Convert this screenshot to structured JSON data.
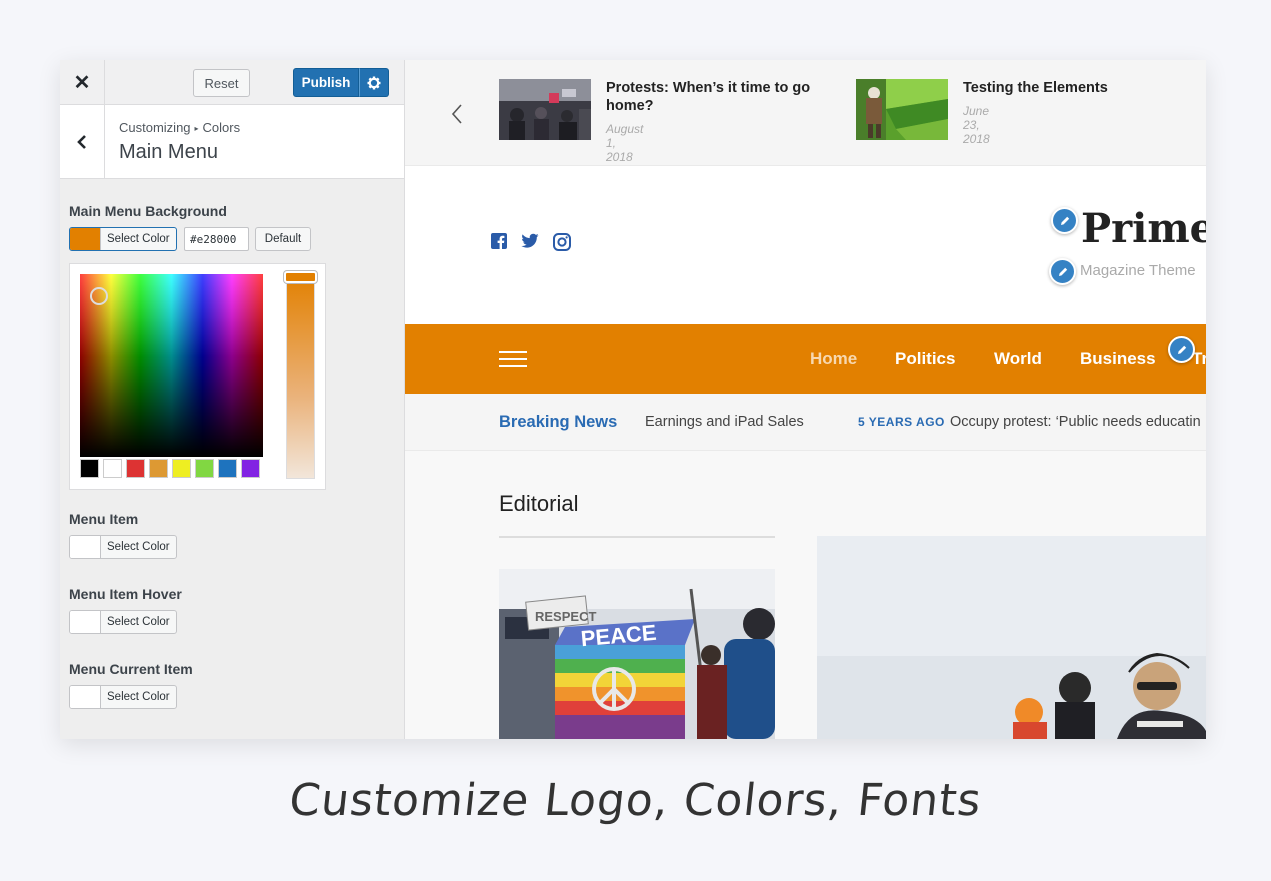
{
  "customizer": {
    "reset_label": "Reset",
    "publish_label": "Publish",
    "breadcrumb_parent": "Customizing",
    "breadcrumb_section": "Colors",
    "section_title": "Main Menu",
    "controls": {
      "menu_background": {
        "label": "Main Menu Background",
        "button_label": "Select Color",
        "hex_value": "#e28000",
        "default_label": "Default",
        "color": "#e28000"
      },
      "menu_item": {
        "label": "Menu Item",
        "button_label": "Select Color"
      },
      "menu_item_hover": {
        "label": "Menu Item Hover",
        "button_label": "Select Color"
      },
      "menu_current_item": {
        "label": "Menu Current Item",
        "button_label": "Select Color"
      }
    },
    "palette": [
      "#000000",
      "#ffffff",
      "#dd3333",
      "#dd9933",
      "#eeee22",
      "#81d742",
      "#1e73be",
      "#8224e3"
    ]
  },
  "preview": {
    "ticker": [
      {
        "title": "Protests: When’s it time to go home?",
        "date": "August 1, 2018"
      },
      {
        "title": "Testing the Elements",
        "date": "June 23, 2018"
      }
    ],
    "site_title": "Prime",
    "site_tagline": "Magazine Theme",
    "menu": [
      "Home",
      "Politics",
      "World",
      "Business",
      "Tr"
    ],
    "breaking": {
      "label": "Breaking News",
      "item_1": "Earnings and iPad Sales",
      "time_ago": "5 YEARS AGO",
      "item_2": "Occupy protest: ‘Public needs educatin"
    },
    "editorial_title": "Editorial",
    "peace_flag_text": "PEACE",
    "respect_sign_text": "RESPECT"
  },
  "caption": "Customize Logo, Colors, Fonts",
  "colors": {
    "accent": "#e28000",
    "wp_blue": "#2271b1",
    "news_blue": "#2a6bb3"
  }
}
